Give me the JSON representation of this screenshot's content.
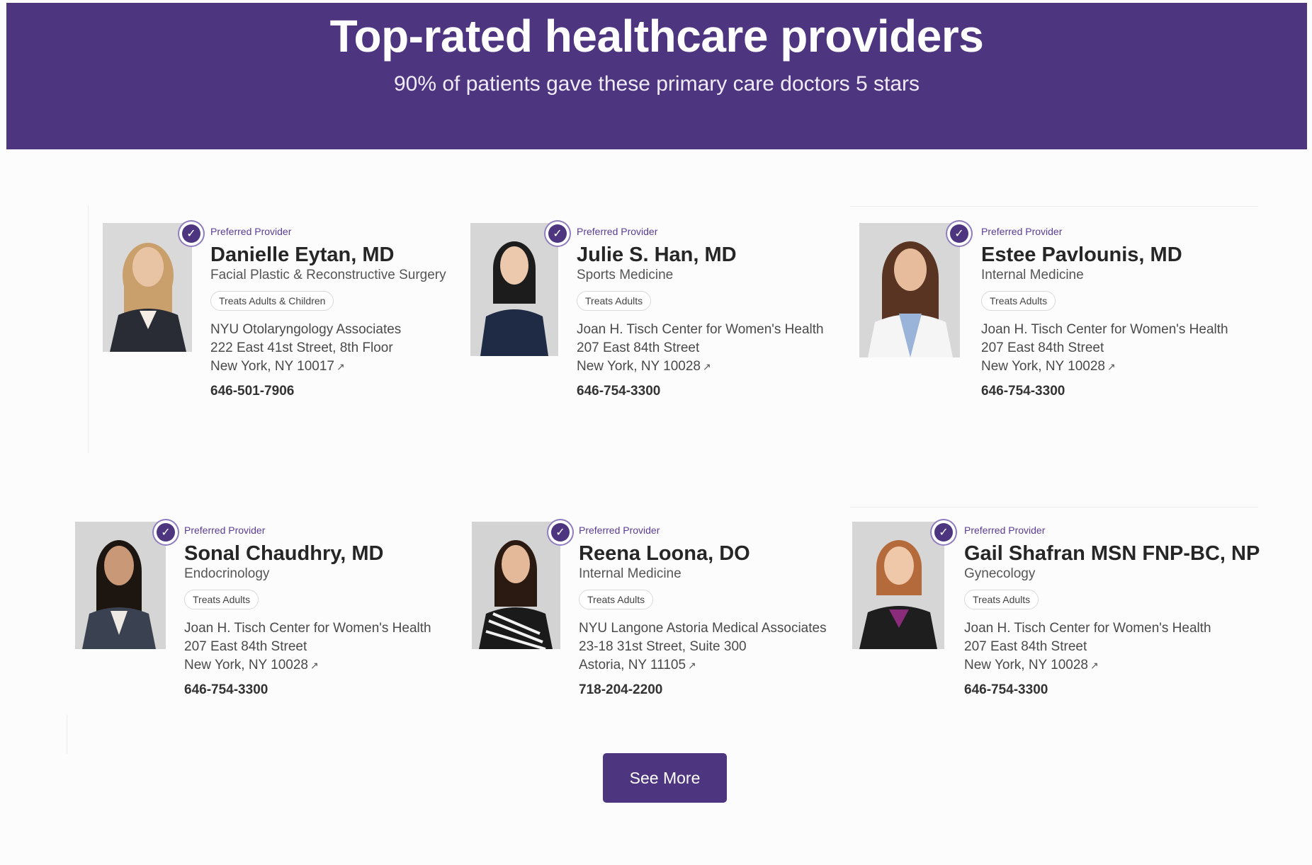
{
  "hero": {
    "title": "Top-rated healthcare providers",
    "subtitle": "90% of patients gave these primary care doctors 5 stars",
    "background_color": "#4e357f"
  },
  "providers": [
    {
      "preferred_label": "Preferred Provider",
      "name": "Danielle Eytan, MD",
      "specialty": "Facial Plastic & Reconstructive Surgery",
      "treats": "Treats Adults & Children",
      "address_line1": "NYU Otolaryngology Associates",
      "address_line2": "222 East 41st Street, 8th Floor",
      "address_line3": "New York, NY 10017",
      "phone": "646-501-7906"
    },
    {
      "preferred_label": "Preferred Provider",
      "name": "Julie S. Han, MD",
      "specialty": "Sports Medicine",
      "treats": "Treats Adults",
      "address_line1": "Joan H. Tisch Center for Women's Health",
      "address_line2": "207 East 84th Street",
      "address_line3": "New York, NY 10028",
      "phone": "646-754-3300"
    },
    {
      "preferred_label": "Preferred Provider",
      "name": "Estee Pavlounis, MD",
      "specialty": "Internal Medicine",
      "treats": "Treats Adults",
      "address_line1": "Joan H. Tisch Center for Women's Health",
      "address_line2": "207 East 84th Street",
      "address_line3": "New York, NY 10028",
      "phone": "646-754-3300"
    },
    {
      "preferred_label": "Preferred Provider",
      "name": "Sonal Chaudhry, MD",
      "specialty": "Endocrinology",
      "treats": "Treats Adults",
      "address_line1": "Joan H. Tisch Center for Women's Health",
      "address_line2": "207 East 84th Street",
      "address_line3": "New York, NY 10028",
      "phone": "646-754-3300"
    },
    {
      "preferred_label": "Preferred Provider",
      "name": "Reena Loona, DO",
      "specialty": "Internal Medicine",
      "treats": "Treats Adults",
      "address_line1": "NYU Langone Astoria Medical Associates",
      "address_line2": "23-18 31st Street, Suite 300",
      "address_line3": "Astoria, NY 11105",
      "phone": "718-204-2200"
    },
    {
      "preferred_label": "Preferred Provider",
      "name": "Gail Shafran MSN FNP-BC, NP",
      "specialty": "Gynecology",
      "treats": "Treats Adults",
      "address_line1": "Joan H. Tisch Center for Women's Health",
      "address_line2": "207 East 84th Street",
      "address_line3": "New York, NY 10028",
      "phone": "646-754-3300"
    }
  ],
  "see_more_label": "See More",
  "icons": {
    "verified": "verified-badge-icon",
    "external_link": "external-link-icon"
  }
}
